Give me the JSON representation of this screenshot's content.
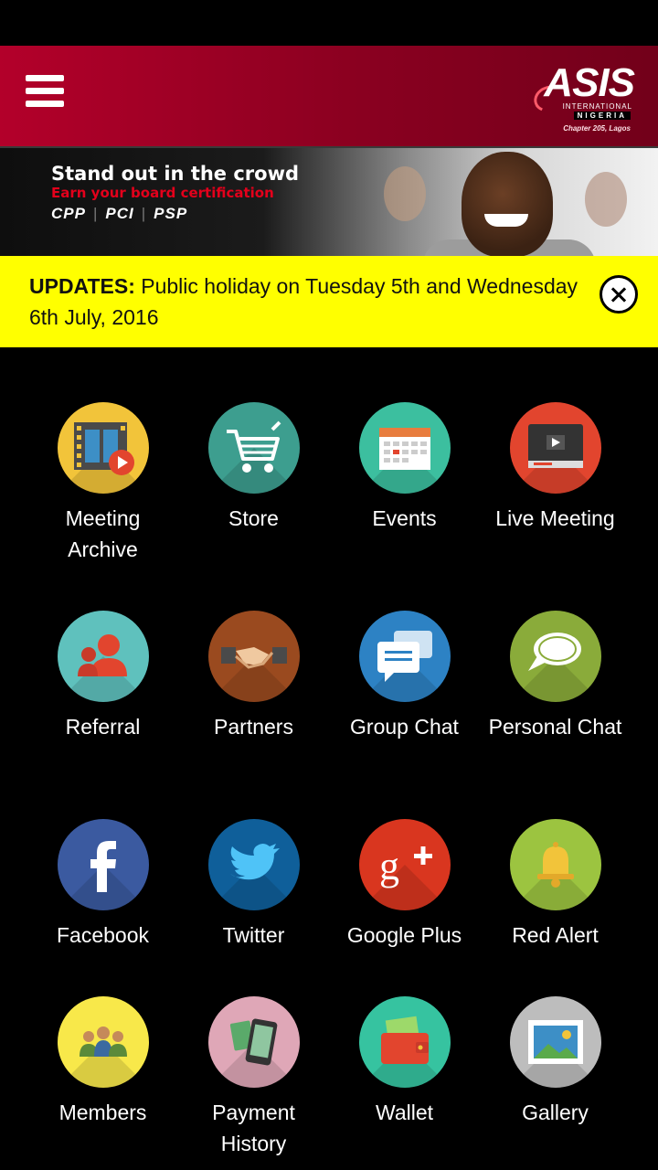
{
  "app": {
    "logo_text": "ASIS",
    "logo_sub": "INTERNATIONAL",
    "logo_country": "NIGERIA",
    "logo_chapter": "Chapter 205, Lagos"
  },
  "banner": {
    "headline": "Stand out in the crowd",
    "subline": "Earn your board certification",
    "certs": [
      "CPP",
      "PCI",
      "PSP"
    ]
  },
  "updates": {
    "label": "UPDATES:",
    "message": " Public holiday on Tuesday 5th and Wednesday 6th July, 2016"
  },
  "tiles": [
    {
      "label": "Meeting Archive",
      "icon": "film-play-icon",
      "color": "#f2c43a"
    },
    {
      "label": "Store",
      "icon": "shopping-cart-icon",
      "color": "#3d9e8f"
    },
    {
      "label": "Events",
      "icon": "calendar-icon",
      "color": "#3cbf9f"
    },
    {
      "label": "Live Meeting",
      "icon": "video-monitor-icon",
      "color": "#e2452e"
    },
    {
      "label": "Referral",
      "icon": "referral-people-icon",
      "color": "#5fc1bd"
    },
    {
      "label": "Partners",
      "icon": "handshake-icon",
      "color": "#9a4a1f"
    },
    {
      "label": "Group Chat",
      "icon": "chat-bubbles-icon",
      "color": "#2d82c4"
    },
    {
      "label": "Personal Chat",
      "icon": "speech-bubble-icon",
      "color": "#8aab3a"
    },
    {
      "label": "Facebook",
      "icon": "facebook-icon",
      "color": "#3b5aa0"
    },
    {
      "label": "Twitter",
      "icon": "twitter-bird-icon",
      "color": "#0f5f9a"
    },
    {
      "label": "Google Plus",
      "icon": "google-plus-icon",
      "color": "#d9361f"
    },
    {
      "label": "Red Alert",
      "icon": "bell-icon",
      "color": "#9cc440"
    },
    {
      "label": "Members",
      "icon": "members-group-icon",
      "color": "#f8e84a"
    },
    {
      "label": "Payment History",
      "icon": "phone-cards-icon",
      "color": "#dfa7b7"
    },
    {
      "label": "Wallet",
      "icon": "wallet-icon",
      "color": "#36c3a0"
    },
    {
      "label": "Gallery",
      "icon": "picture-icon",
      "color": "#bdbdbd"
    }
  ]
}
